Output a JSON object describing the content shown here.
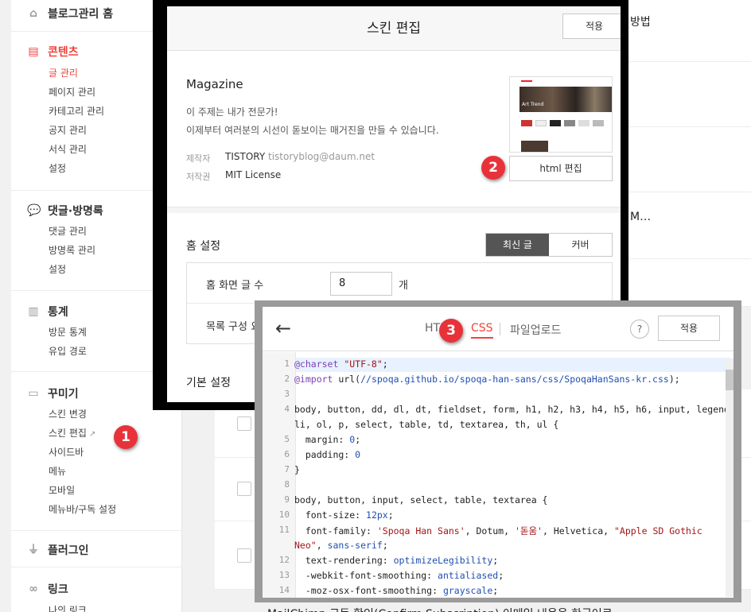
{
  "sidebar": {
    "blog_home": "블로그관리 홈",
    "contents": {
      "title": "콘텐츠",
      "items": [
        "글 관리",
        "페이지 관리",
        "카테고리 관리",
        "공지 관리",
        "서식 관리",
        "설정"
      ]
    },
    "comments": {
      "title": "댓글·방명록",
      "items": [
        "댓글 관리",
        "방명록 관리",
        "설정"
      ]
    },
    "stats": {
      "title": "통계",
      "items": [
        "방문 통계",
        "유입 경로"
      ]
    },
    "decorate": {
      "title": "꾸미기",
      "items": [
        "스킨 변경",
        "스킨 편집",
        "사이드바",
        "메뉴",
        "모바일",
        "메뉴바/구독 설정"
      ]
    },
    "plugin": {
      "title": "플러그인"
    },
    "link": {
      "title": "링크",
      "items": [
        "나의 링크"
      ]
    }
  },
  "background": {
    "snippet_top": "방법",
    "snippet_mid": "M…",
    "snippet_bottom": "MailChimp 구독 확인(Confirm Subscription) 이메일 내용을 한국어로"
  },
  "skin_editor": {
    "title": "스킨 편집",
    "apply_label": "적용",
    "theme_name": "Magazine",
    "desc_line1": "이 주제는 내가 전문가!",
    "desc_line2": "이제부터 여러분의 시선이 돋보이는 매거진을 만들 수 있습니다.",
    "maker_key": "제작자",
    "maker_value": "TISTORY",
    "maker_email": "tistoryblog@daum.net",
    "license_key": "저작권",
    "license_value": "MIT License",
    "thumb_caption": "Art Trend",
    "html_edit_label": "html 편집",
    "home_settings_title": "홈 설정",
    "tab_latest": "최신 글",
    "tab_cover": "커버",
    "home_post_count_label": "홈 화면 글 수",
    "home_post_count_value": "8",
    "home_post_count_unit": "개",
    "list_config_label": "목록 구성 요",
    "basic_settings_title": "기본 설정"
  },
  "css_editor": {
    "tab_html": "HTML",
    "tab_css": "CSS",
    "tab_upload": "파일업로드",
    "help": "?",
    "apply_label": "적용",
    "line_numbers": [
      "1",
      "2",
      "3",
      "4",
      "",
      "5",
      "6",
      "7",
      "8",
      "9",
      "10",
      "11",
      "",
      "12",
      "13",
      "14"
    ],
    "code": {
      "l1a": "@charset ",
      "l1b": "\"UTF-8\"",
      "l1c": ";",
      "l2a": "@import ",
      "l2b": "url(",
      "l2c": "//spoqa.github.io/spoqa-han-sans/css/SpoqaHanSans-kr.css",
      "l2d": ");",
      "l4": "body, button, dd, dl, dt, fieldset, form, h1, h2, h3, h4, h5, h6, input, legend,",
      "l4b": "li, ol, p, select, table, td, textarea, th, ul {",
      "l5a": "  margin: ",
      "l5b": "0",
      "l5c": ";",
      "l6a": "  padding: ",
      "l6b": "0",
      "l7": "}",
      "l9": "body, button, input, select, table, textarea {",
      "l10a": "  font-size: ",
      "l10b": "12px",
      "l10c": ";",
      "l11a": "  font-family: ",
      "l11b": "'Spoqa Han Sans'",
      "l11c": ", Dotum, ",
      "l11d": "'돋움'",
      "l11e": ", Helvetica, ",
      "l11f": "\"Apple SD Gothic",
      "l11g": "Neo\"",
      "l11h": ", ",
      "l11i": "sans-serif",
      "l11j": ";",
      "l12a": "  text-rendering: ",
      "l12b": "optimizeLegibility",
      "l12c": ";",
      "l13a": "  -webkit-font-smoothing: ",
      "l13b": "antialiased",
      "l13c": ";",
      "l14a": "  -moz-osx-font-smoothing: ",
      "l14b": "grayscale",
      "l14c": ";"
    }
  },
  "callouts": [
    "1",
    "2",
    "3"
  ],
  "colors": {
    "accent": "#f0433a",
    "callout": "#e8323a"
  }
}
